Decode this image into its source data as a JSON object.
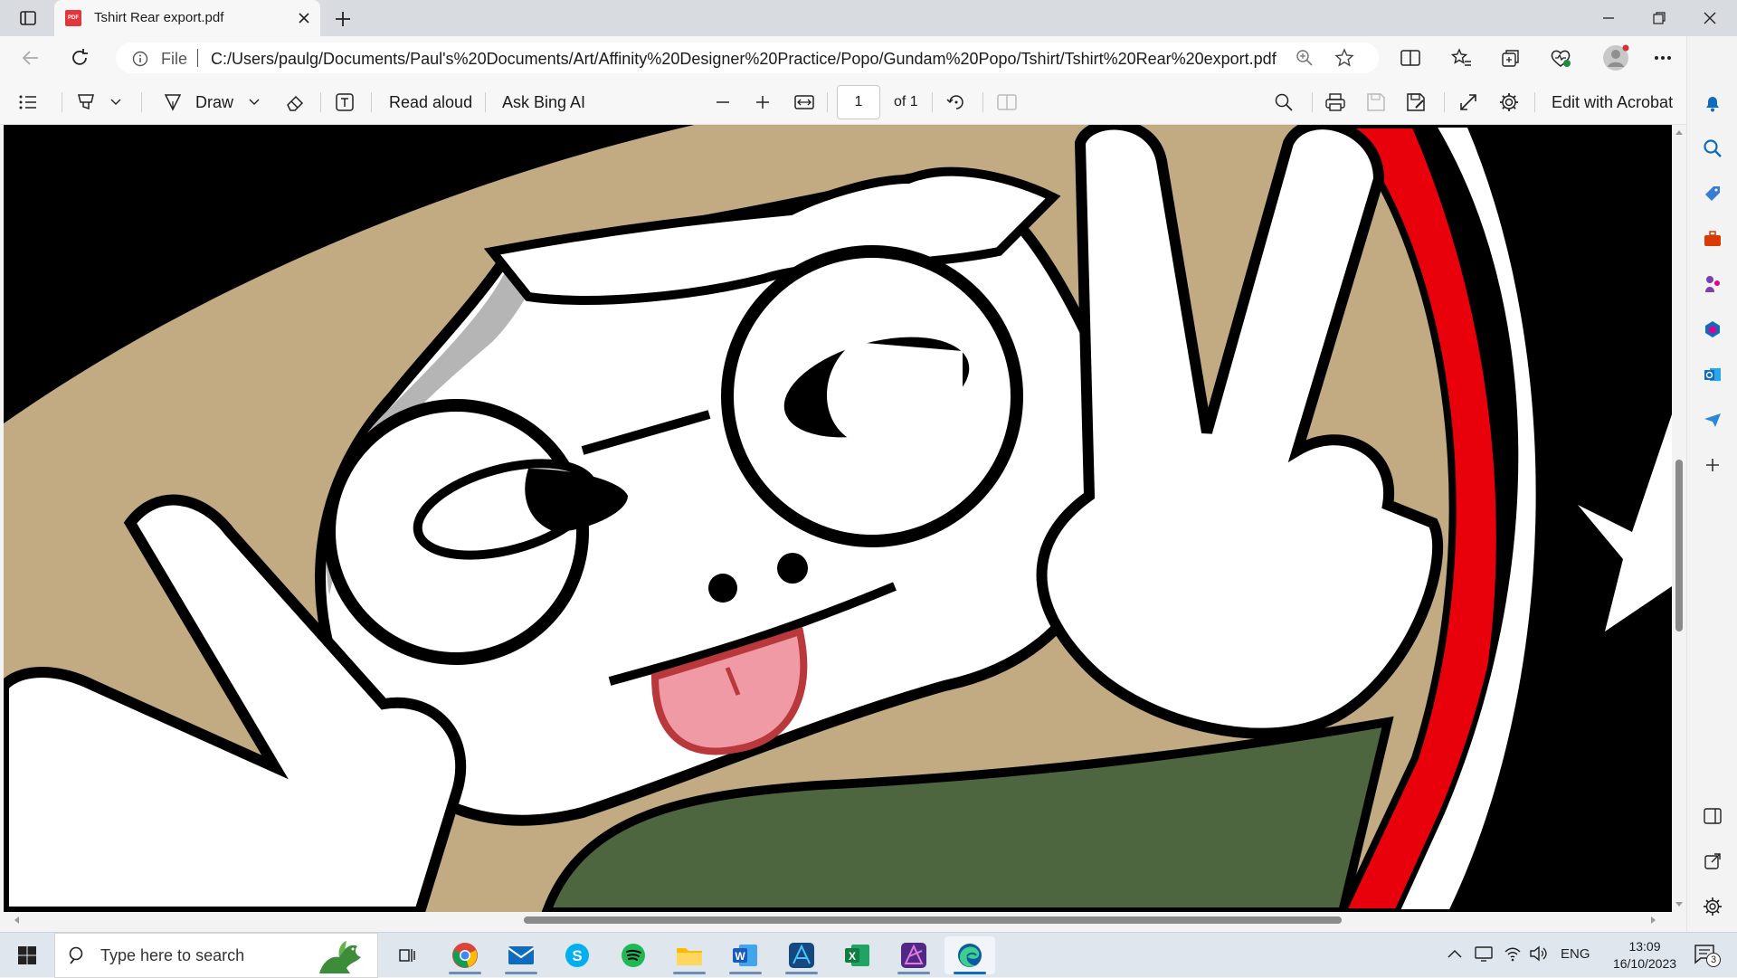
{
  "browser": {
    "tab_title": "Tshirt Rear export.pdf",
    "favicon_text": "PDF",
    "address_prefix": "File",
    "url": "C:/Users/paulg/Documents/Paul's%20Documents/Art/Affinity%20Designer%20Practice/Popo/Gundam%20Popo/Tshirt/Tshirt%20Rear%20export.pdf"
  },
  "pdf_toolbar": {
    "draw_label": "Draw",
    "read_aloud_label": "Read aloud",
    "ask_bing_label": "Ask Bing AI",
    "page_number": "1",
    "page_total": "of 1",
    "edit_acrobat_label": "Edit with Acrobat"
  },
  "taskbar": {
    "search_placeholder": "Type here to search",
    "language": "ENG",
    "time": "13:09",
    "date": "16/10/2023",
    "notification_count": "3"
  },
  "colors": {
    "accent_blue": "#0f6cbd",
    "pdf_red": "#e2363c",
    "artwork_tan": "#c2aa82",
    "artwork_green": "#4e6640",
    "artwork_red": "#e8000b"
  }
}
